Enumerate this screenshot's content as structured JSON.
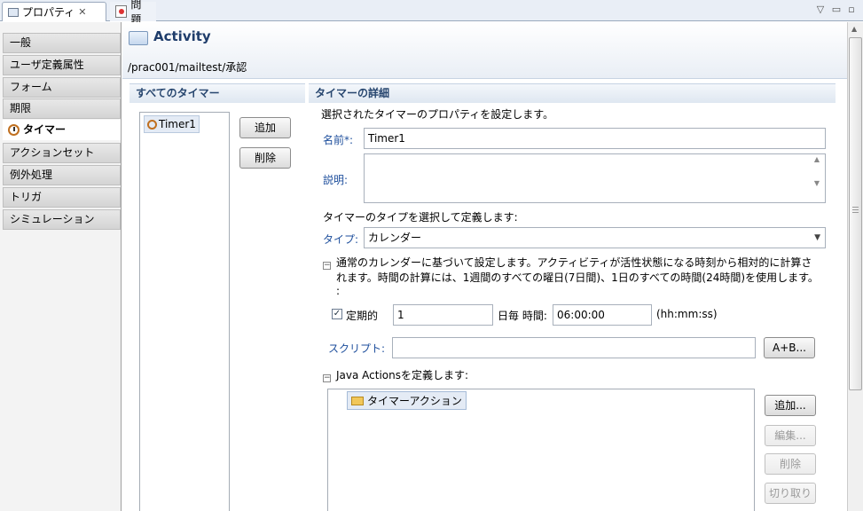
{
  "tabs": {
    "properties": "プロパティ",
    "problems": "問題"
  },
  "window_controls": {
    "menu": "▽",
    "minimize": "▭",
    "restore": "▫"
  },
  "nav": [
    "一般",
    "ユーザ定義属性",
    "フォーム",
    "期限",
    "タイマー",
    "アクションセット",
    "例外処理",
    "トリガ",
    "シミュレーション"
  ],
  "nav_active_index": 4,
  "header": {
    "title": "Activity",
    "path": "/prac001/mailtest/承認"
  },
  "all_timers": {
    "title": "すべてのタイマー",
    "items": [
      "Timer1"
    ],
    "add_label": "追加",
    "delete_label": "削除"
  },
  "detail": {
    "title": "タイマーの詳細",
    "intro": "選択されたタイマーのプロパティを設定します。",
    "name_label": "名前*:",
    "name_value": "Timer1",
    "desc_label": "説明:",
    "desc_value": "",
    "type_intro": "タイマーのタイプを選択して定義します:",
    "type_label": "タイプ:",
    "type_value": "カレンダー",
    "calendar_text1": "通常のカレンダーに基づいて設定します。アクティビティが活性状態になる時刻から相対的に計算さ",
    "calendar_text2": "れます。時間の計算には、1週間のすべての曜日(7日間)、1日のすべての時間(24時間)を使用します。",
    "calendar_text3": ":",
    "periodic_label": "定期的",
    "periodic_checked": true,
    "periodic_value": "1",
    "every_day_label": "日毎 時間:",
    "time_value": "06:00:00",
    "time_format": "(hh:mm:ss)",
    "script_label": "スクリプト:",
    "script_value": "",
    "script_button": "A+B...",
    "java_actions_label": "Java Actionsを定義します:",
    "actions": [
      "タイマーアクション"
    ],
    "btn_add": "追加...",
    "btn_edit": "編集...",
    "btn_delete": "削除",
    "btn_cut": "切り取り"
  }
}
